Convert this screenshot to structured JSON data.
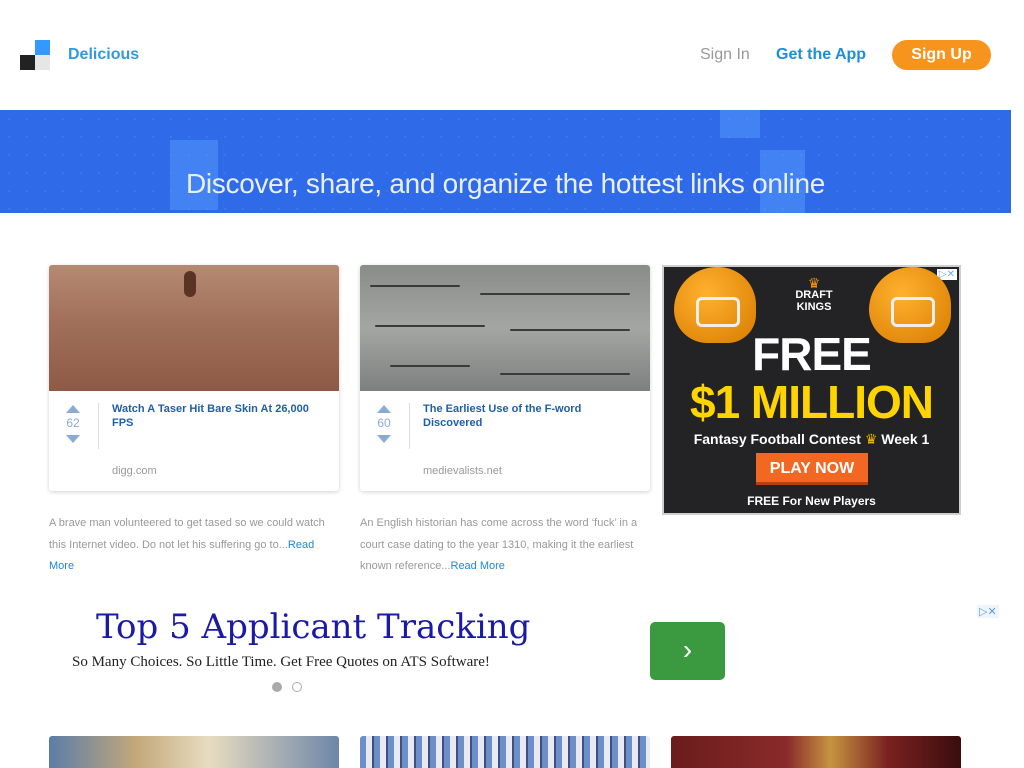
{
  "header": {
    "brand": "Delicious",
    "sign_in": "Sign In",
    "get_app": "Get the App",
    "sign_up": "Sign Up"
  },
  "hero": {
    "tagline": "Discover, share, and organize the hottest links online"
  },
  "cards": [
    {
      "votes": "62",
      "title": "Watch A Taser Hit Bare Skin At 26,000 FPS",
      "domain": "digg.com",
      "description": "A brave man volunteered to get tased so we could watch this Internet video. Do not let his suffering go to...",
      "read_more": "Read More"
    },
    {
      "votes": "60",
      "title": "The Earliest Use of the F-word Discovered",
      "domain": "medievalists.net",
      "description": "An English historian has come across the word ‘fuck’ in a court case dating to the year 1310, making it the earliest known reference...",
      "read_more": "Read More"
    }
  ],
  "side_ad": {
    "logo_line1": "DRAFT",
    "logo_line2": "KINGS",
    "free": "FREE",
    "million": "$1 MILLION",
    "contest": "Fantasy Football Contest",
    "week": "Week 1",
    "button": "PLAY NOW",
    "new_players": "FREE For New Players",
    "adchoices": "▷✕"
  },
  "banner_ad": {
    "title": "Top 5 Applicant Tracking",
    "subtitle": "So Many Choices. So Little Time. Get Free Quotes on ATS Software!",
    "arrow": "›",
    "adchoices": "▷✕"
  }
}
